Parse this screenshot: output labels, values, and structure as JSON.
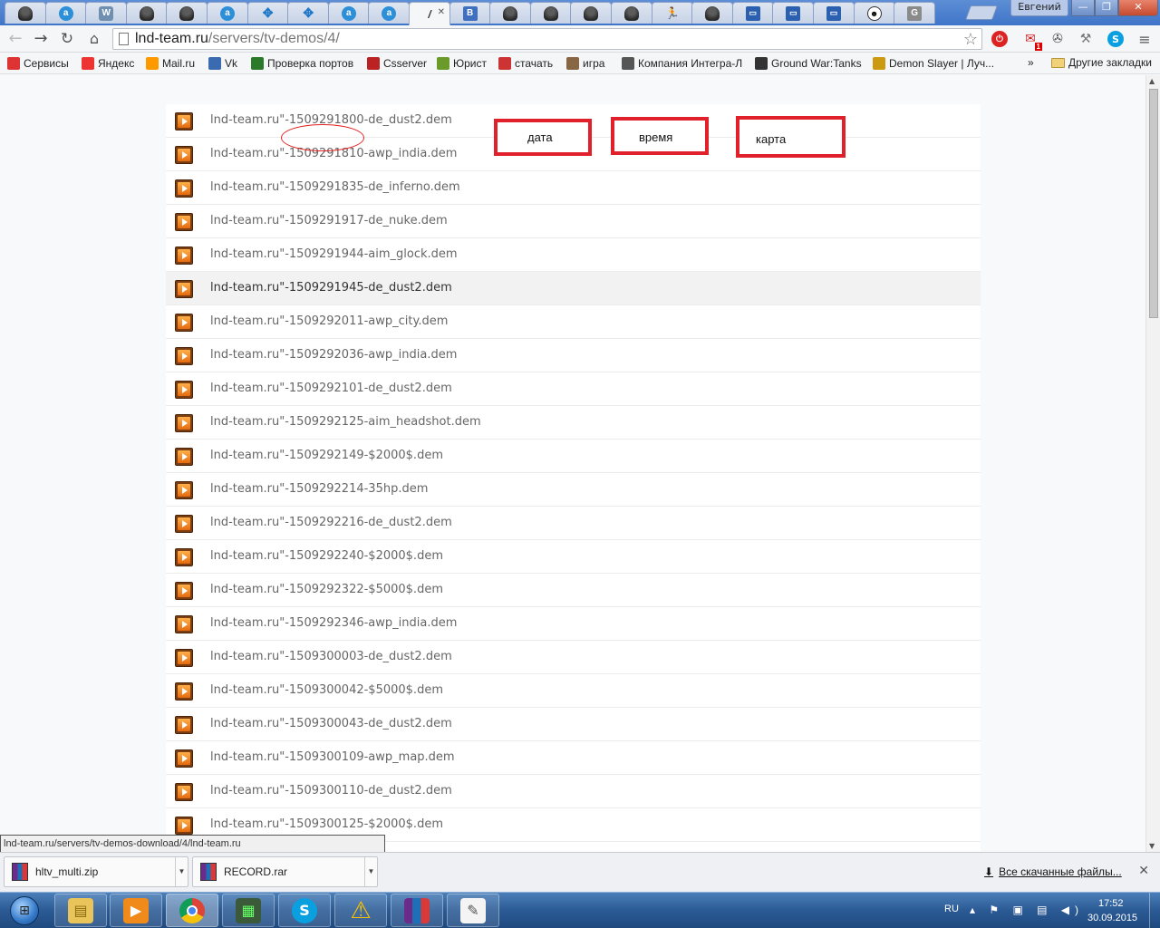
{
  "window": {
    "user_name": "Евгений",
    "min": "—",
    "max": "❐",
    "close": "✕"
  },
  "tabs": [
    {
      "icon": "avatar",
      "glyph": ""
    },
    {
      "icon": "ahead",
      "glyph": "a"
    },
    {
      "icon": "w",
      "glyph": "W"
    },
    {
      "icon": "avatar",
      "glyph": ""
    },
    {
      "icon": "avatar",
      "glyph": ""
    },
    {
      "icon": "ahead",
      "glyph": "a"
    },
    {
      "icon": "puzzle",
      "glyph": "✥"
    },
    {
      "icon": "puzzle",
      "glyph": "✥"
    },
    {
      "icon": "ahead",
      "glyph": "a"
    },
    {
      "icon": "ahead",
      "glyph": "a"
    },
    {
      "icon": "slash",
      "glyph": "/"
    },
    {
      "icon": "doc",
      "glyph": "B"
    },
    {
      "icon": "avatar",
      "glyph": ""
    },
    {
      "icon": "avatar",
      "glyph": ""
    },
    {
      "icon": "avatar",
      "glyph": ""
    },
    {
      "icon": "avatar",
      "glyph": ""
    },
    {
      "icon": "runner",
      "glyph": "🏃"
    },
    {
      "icon": "avatar",
      "glyph": ""
    },
    {
      "icon": "chat",
      "glyph": "▭"
    },
    {
      "icon": "chat",
      "glyph": "▭"
    },
    {
      "icon": "chat",
      "glyph": "▭"
    },
    {
      "icon": "face",
      "glyph": "☻"
    },
    {
      "icon": "gicon",
      "glyph": "G"
    }
  ],
  "toolbar": {
    "url_host": "lnd-team.ru",
    "url_path": "/servers/tv-demos/4/"
  },
  "bookmarks": [
    {
      "label": "Сервисы",
      "color": "#d33"
    },
    {
      "label": "Яндекс",
      "color": "#e33"
    },
    {
      "label": "Mail.ru",
      "color": "#f90"
    },
    {
      "label": "Vk",
      "color": "#3a6ab0"
    },
    {
      "label": "Проверка портов",
      "color": "#2a7a2a"
    },
    {
      "label": "Csserver",
      "color": "#b22"
    },
    {
      "label": "Юрист",
      "color": "#6a9a2a"
    },
    {
      "label": "стачать",
      "color": "#c33"
    },
    {
      "label": "игра",
      "color": "#864"
    },
    {
      "label": "Компания Интегра-Л",
      "color": "#555"
    },
    {
      "label": "Ground War:Tanks",
      "color": "#333"
    },
    {
      "label": "Demon Slayer | Луч...",
      "color": "#cc9a10"
    }
  ],
  "bookmarks_more": "»",
  "bookmarks_other": "Другие закладки",
  "files": [
    "lnd-team.ru\"-1509291800-de_dust2.dem",
    "lnd-team.ru\"-1509291810-awp_india.dem",
    "lnd-team.ru\"-1509291835-de_inferno.dem",
    "lnd-team.ru\"-1509291917-de_nuke.dem",
    "lnd-team.ru\"-1509291944-aim_glock.dem",
    "lnd-team.ru\"-1509291945-de_dust2.dem",
    "lnd-team.ru\"-1509292011-awp_city.dem",
    "lnd-team.ru\"-1509292036-awp_india.dem",
    "lnd-team.ru\"-1509292101-de_dust2.dem",
    "lnd-team.ru\"-1509292125-aim_headshot.dem",
    "lnd-team.ru\"-1509292149-$2000$.dem",
    "lnd-team.ru\"-1509292214-35hp.dem",
    "lnd-team.ru\"-1509292216-de_dust2.dem",
    "lnd-team.ru\"-1509292240-$2000$.dem",
    "lnd-team.ru\"-1509292322-$5000$.dem",
    "lnd-team.ru\"-1509292346-awp_india.dem",
    "lnd-team.ru\"-1509300003-de_dust2.dem",
    "lnd-team.ru\"-1509300042-$5000$.dem",
    "lnd-team.ru\"-1509300043-de_dust2.dem",
    "lnd-team.ru\"-1509300109-awp_map.dem",
    "lnd-team.ru\"-1509300110-de_dust2.dem",
    "lnd-team.ru\"-1509300125-$2000$.dem"
  ],
  "highlighted_row": 5,
  "annotations": {
    "date": "дата",
    "time": "время",
    "map": "карта"
  },
  "status_url": "lnd-team.ru/servers/tv-demos-download/4/lnd-team.ru",
  "downloads": {
    "items": [
      "hltv_multi.zip",
      "RECORD.rar"
    ],
    "all_label": "Все скачанные файлы..."
  },
  "taskbar": {
    "lang": "RU",
    "time": "17:52",
    "date": "30.09.2015"
  }
}
